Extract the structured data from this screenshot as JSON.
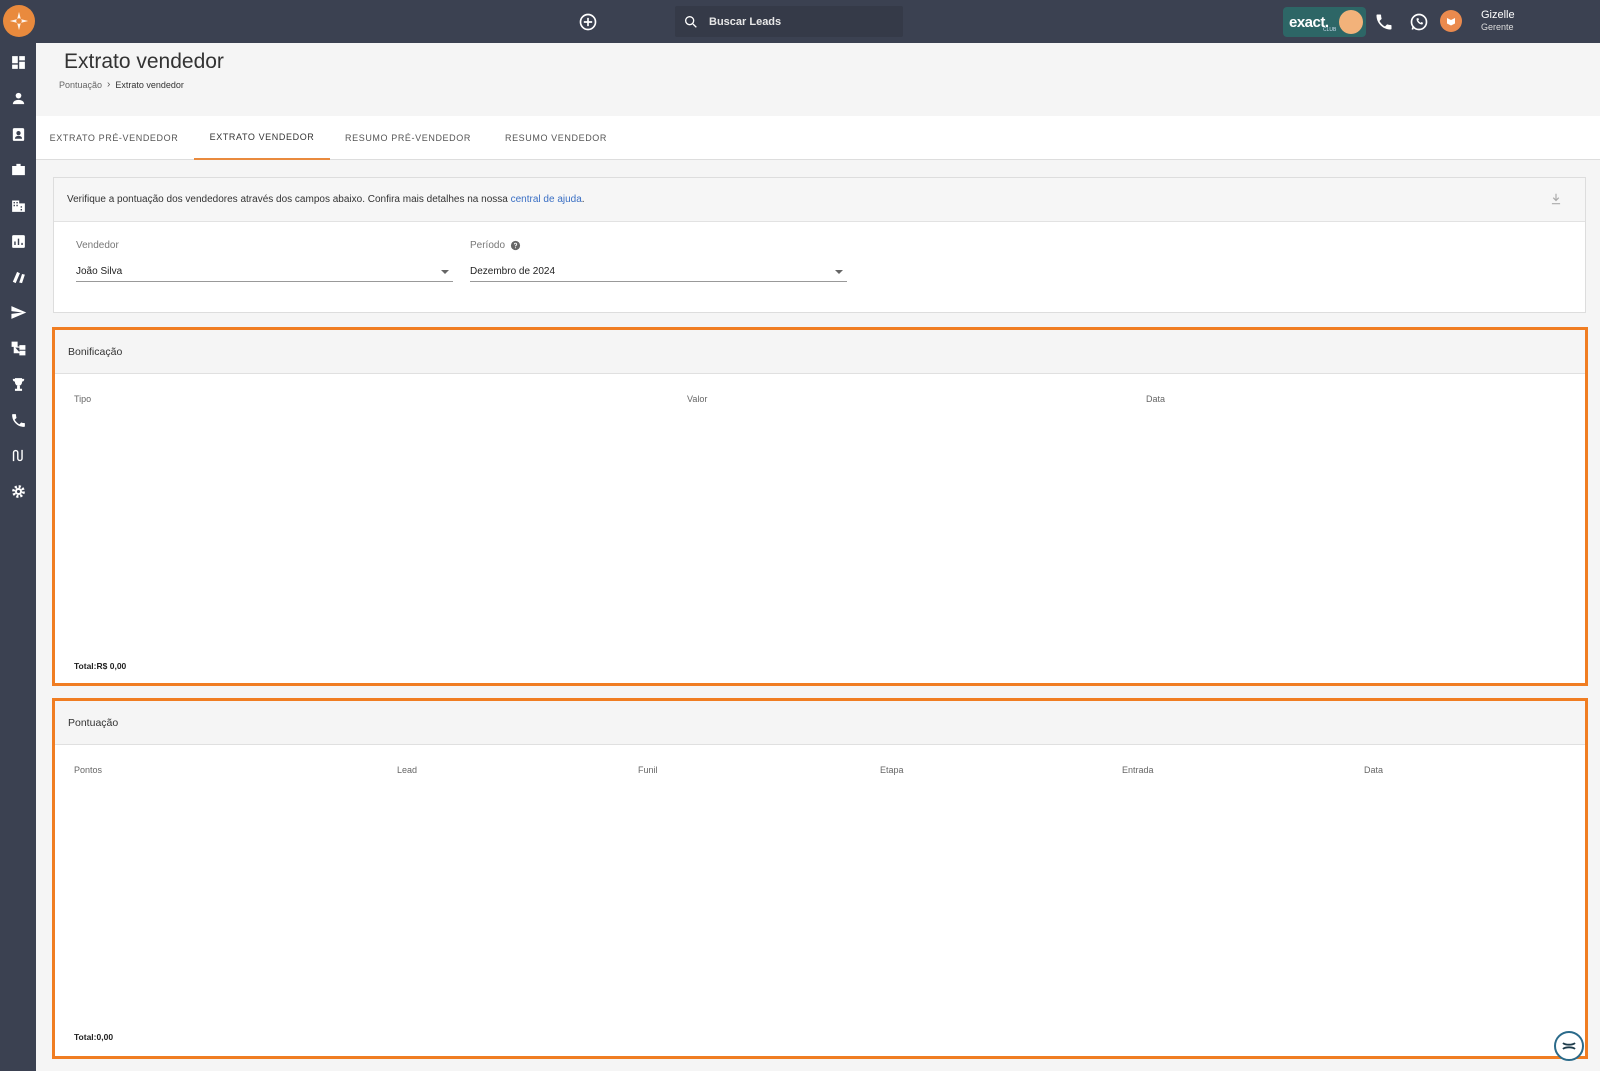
{
  "topbar": {
    "search_placeholder": "Buscar Leads",
    "exact_badge": "exact.",
    "exact_sub": "CLUB",
    "user_name": "Gizelle",
    "user_role": "Gerente"
  },
  "sidebar": {
    "icons": [
      "dashboard-icon",
      "person-icon",
      "contacts-icon",
      "briefcase-icon",
      "building-icon",
      "analytics-icon",
      "books-icon",
      "send-icon",
      "hierarchy-icon",
      "trophy-icon",
      "phone-icon",
      "routes-icon",
      "gear-icon"
    ]
  },
  "page": {
    "title": "Extrato vendedor",
    "breadcrumb_parent": "Pontuação",
    "breadcrumb_current": "Extrato vendedor"
  },
  "tabs": [
    {
      "label": "EXTRATO PRÉ-VENDEDOR"
    },
    {
      "label": "EXTRATO VENDEDOR",
      "active": true
    },
    {
      "label": "RESUMO PRÉ-VENDEDOR"
    },
    {
      "label": "RESUMO VENDEDOR"
    }
  ],
  "filters": {
    "info_text": "Verifique a pontuação dos vendedores através dos campos abaixo. Confira mais detalhes na nossa ",
    "info_link": "central de ajuda",
    "info_end": ".",
    "vendedor_label": "Vendedor",
    "vendedor_value": "João Silva",
    "periodo_label": "Período",
    "periodo_value": "Dezembro de 2024"
  },
  "bonificacao": {
    "title": "Bonificação",
    "columns": [
      "Tipo",
      "Valor",
      "Data"
    ],
    "total": "Total:R$ 0,00"
  },
  "pontuacao": {
    "title": "Pontuação",
    "columns": [
      "Pontos",
      "Lead",
      "Funil",
      "Etapa",
      "Entrada",
      "Data"
    ],
    "total": "Total:0,00"
  },
  "colors": {
    "topbar": "#3b4151",
    "accent": "#f07d22",
    "link": "#3a6fc4"
  }
}
